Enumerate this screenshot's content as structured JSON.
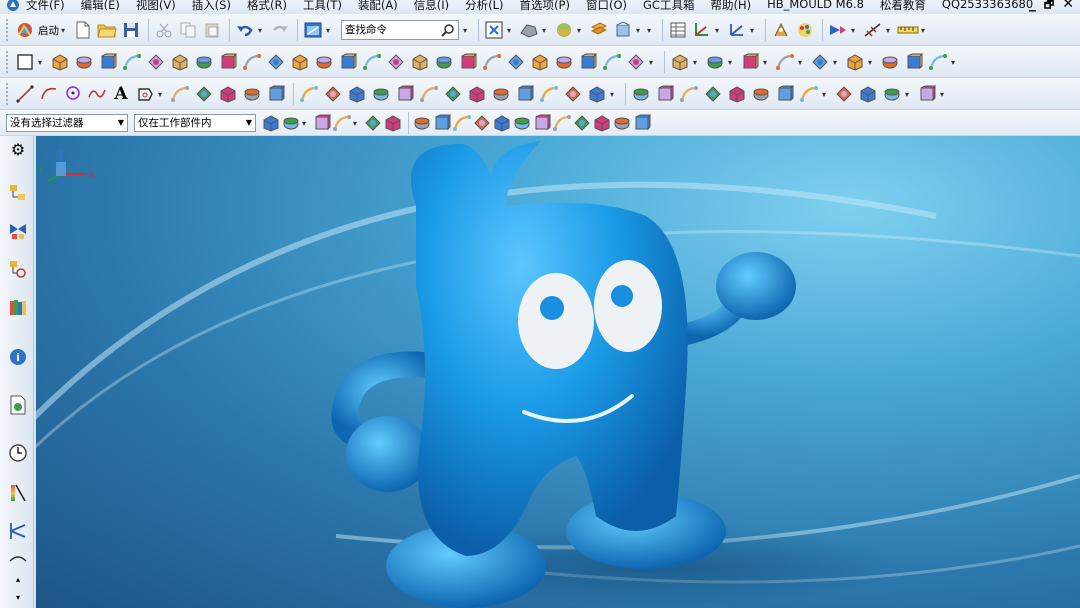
{
  "menubar": {
    "items": [
      "文件(F)",
      "编辑(E)",
      "视图(V)",
      "插入(S)",
      "格式(R)",
      "工具(T)",
      "装配(A)",
      "信息(I)",
      "分析(L)",
      "首选项(P)",
      "窗口(O)",
      "GC工具箱",
      "帮助(H)",
      "HB_MOULD M6.8",
      "松着教育",
      "QQ2533363680"
    ],
    "minimize": "_",
    "restore": "🗗",
    "close": "✕"
  },
  "toolbar1": {
    "start_label": "启动",
    "search_placeholder": "查找命令"
  },
  "selection_bar": {
    "filter_value": "没有选择过滤器",
    "scope_value": "仅在工作部件内"
  },
  "colors": {
    "accent": "#1e8fe0",
    "viewport_top": "#7fd0ef",
    "viewport_bottom": "#1d5585",
    "model": "#1a9ae6"
  },
  "viewport": {
    "triad_x": "X",
    "triad_y": "Y"
  }
}
